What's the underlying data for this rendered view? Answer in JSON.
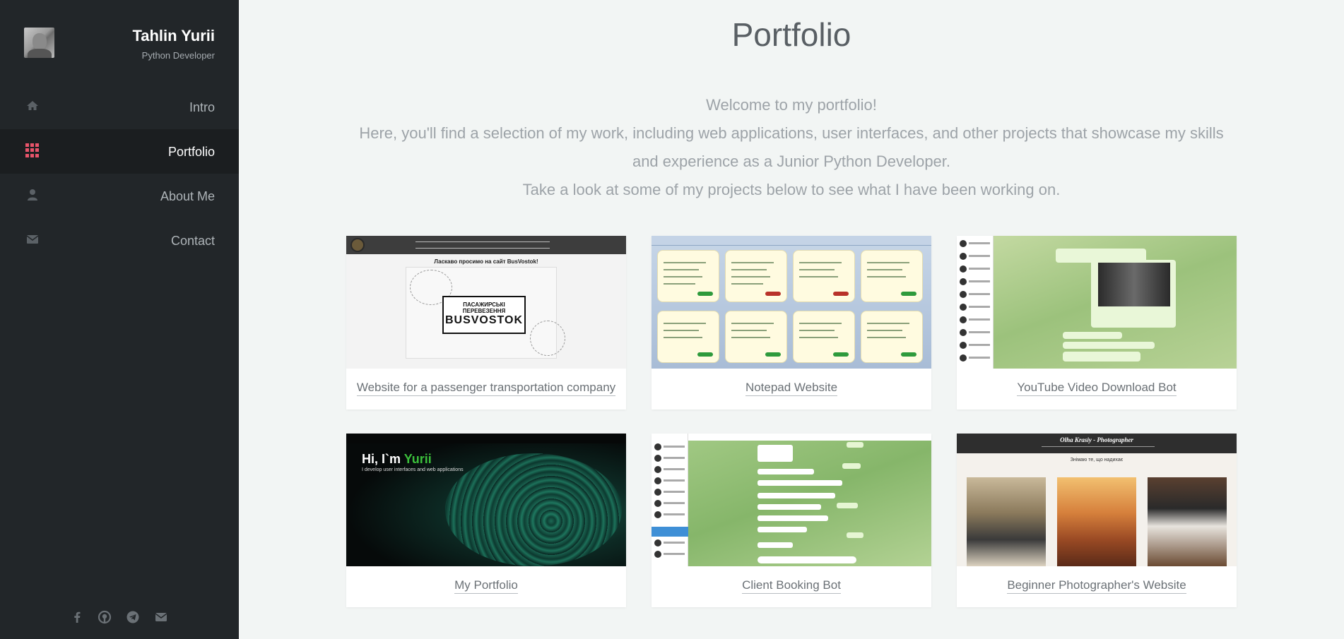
{
  "sidebar": {
    "profile": {
      "name": "Tahlin Yurii",
      "role": "Python Developer"
    },
    "nav": [
      {
        "label": "Intro",
        "icon": "home-icon",
        "active": false
      },
      {
        "label": "Portfolio",
        "icon": "grid-icon",
        "active": true
      },
      {
        "label": "About Me",
        "icon": "user-icon",
        "active": false
      },
      {
        "label": "Contact",
        "icon": "envelope-icon",
        "active": false
      }
    ],
    "social": [
      "facebook-icon",
      "github-icon",
      "telegram-icon",
      "email-icon"
    ]
  },
  "main": {
    "title": "Portfolio",
    "intro": {
      "line1": "Welcome to my portfolio!",
      "line2": "Here, you'll find a selection of my work, including web applications, user interfaces, and other projects that showcase my skills and experience as a Junior Python Developer.",
      "line3": "Take a look at some of my projects below to see what I have been working on."
    },
    "projects": [
      {
        "title": "Website for a passenger transportation company",
        "thumb": {
          "heading": "Ласкаво просимо на сайт BusVostok!",
          "box_line1": "ПАСАЖИРСЬКІ ПЕРЕВЕЗЕННЯ",
          "box_line2": "BUSVOSTOK"
        }
      },
      {
        "title": "Notepad Website"
      },
      {
        "title": "YouTube Video Download Bot"
      },
      {
        "title": "My Portfolio",
        "thumb": {
          "greeting_prefix": "Hi, I`m ",
          "greeting_name": "Yurii",
          "subtitle": "I develop user interfaces and web applications"
        }
      },
      {
        "title": "Client Booking Bot"
      },
      {
        "title": "Beginner Photographer's Website",
        "thumb": {
          "site_title": "Olha Krasiy - Photographer",
          "heading": "Знімаю те, що надихає"
        }
      }
    ]
  },
  "colors": {
    "sidebar_bg": "#222629",
    "active_nav_bg": "#1b1e20",
    "accent_icon": "#e8546a",
    "main_bg": "#f2f5f4",
    "text_muted": "#9da3a8"
  }
}
